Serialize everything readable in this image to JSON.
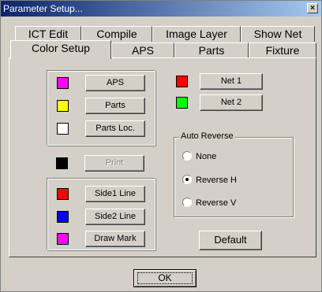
{
  "window": {
    "title": "Parameter Setup...",
    "close": "×"
  },
  "tabs": {
    "row1": [
      "ICT Edit",
      "Compile",
      "Image Layer",
      "Show Net"
    ],
    "row2": [
      "Color Setup",
      "APS",
      "Parts",
      "Fixture"
    ],
    "active": "Color Setup"
  },
  "colors": {
    "aps": "#ff00ff",
    "parts": "#ffff00",
    "parts_loc": "#ffffff",
    "print": "#000000",
    "side1_line": "#ff0000",
    "side2_line": "#0000ff",
    "draw_mark": "#ff00ff",
    "net1": "#ff0000",
    "net2": "#00ff00"
  },
  "buttons": {
    "aps": "APS",
    "parts": "Parts",
    "parts_loc": "Parts Loc.",
    "print": "Print",
    "side1_line": "Side1 Line",
    "side2_line": "Side2 Line",
    "draw_mark": "Draw Mark",
    "net1": "Net 1",
    "net2": "Net 2",
    "default": "Default",
    "ok": "OK"
  },
  "auto_reverse": {
    "title": "Auto Reverse",
    "options": [
      "None",
      "Reverse H",
      "Reverse V"
    ],
    "selected": "Reverse H"
  }
}
